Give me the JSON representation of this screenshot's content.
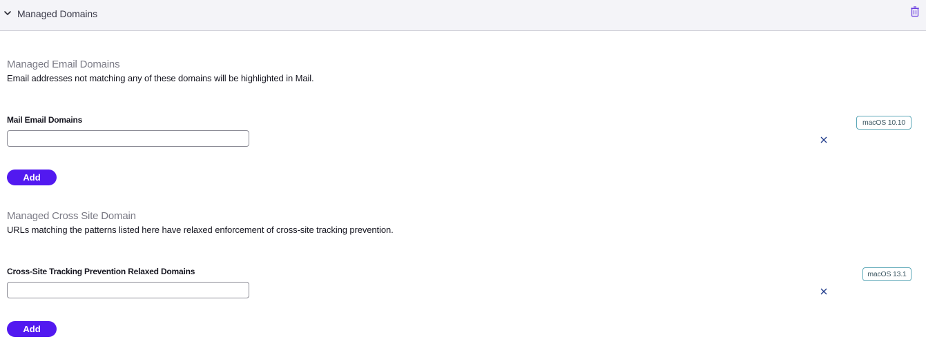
{
  "header": {
    "title": "Managed Domains",
    "collapse_icon": "chevron-down-icon",
    "delete_icon": "trash-icon"
  },
  "sections": [
    {
      "title": "Managed Email Domains",
      "description": "Email addresses not matching any of these domains will be highlighted in Mail.",
      "field_label": "Mail Email Domains",
      "input_value": "",
      "input_placeholder": "",
      "badge": "macOS 10.10",
      "add_label": "Add"
    },
    {
      "title": "Managed Cross Site Domain",
      "description": "URLs matching the patterns listed here have relaxed enforcement of cross-site tracking prevention.",
      "field_label": "Cross-Site Tracking Prevention Relaxed Domains",
      "input_value": "",
      "input_placeholder": "",
      "badge": "macOS 13.1",
      "add_label": "Add"
    }
  ],
  "colors": {
    "accent": "#5219f0",
    "badge_border": "#5ba7b7",
    "trash": "#6a3de0",
    "remove_x": "#1e3a8a"
  }
}
